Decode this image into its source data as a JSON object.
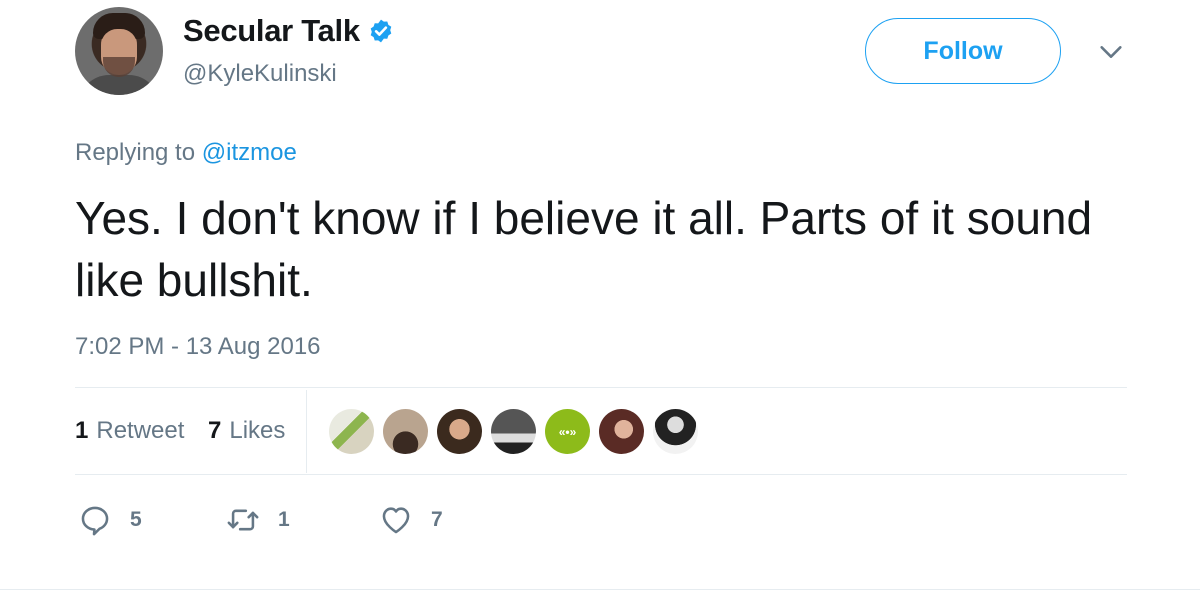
{
  "author": {
    "display_name": "Secular Talk",
    "handle": "@KyleKulinski",
    "verified": true,
    "avatar_icon": "user-avatar"
  },
  "follow_button": {
    "label": "Follow"
  },
  "more_menu": {
    "icon": "chevron-down-icon"
  },
  "reply_context": {
    "prefix": "Replying to ",
    "mention": "@itzmoe"
  },
  "tweet": {
    "text": "Yes. I don't know if I believe it all. Parts of it sound like bullshit.",
    "timestamp": "7:02 PM - 13 Aug 2016"
  },
  "stats": {
    "retweets": {
      "count": "1",
      "label": "Retweet"
    },
    "likes": {
      "count": "7",
      "label": "Likes"
    }
  },
  "likers": [
    {
      "icon": "liker-avatar-1"
    },
    {
      "icon": "liker-avatar-2"
    },
    {
      "icon": "liker-avatar-3"
    },
    {
      "icon": "liker-avatar-4"
    },
    {
      "icon": "liker-avatar-5",
      "text": "«•»"
    },
    {
      "icon": "liker-avatar-6"
    },
    {
      "icon": "liker-avatar-7"
    }
  ],
  "actions": {
    "reply": {
      "icon": "reply-icon",
      "count": "5"
    },
    "retweet": {
      "icon": "retweet-icon",
      "count": "1"
    },
    "like": {
      "icon": "heart-icon",
      "count": "7"
    }
  },
  "colors": {
    "accent": "#1da1f2",
    "link": "#1b95e0",
    "secondary_text": "#657786",
    "primary_text": "#14171a",
    "divider": "#e6ecf0"
  }
}
